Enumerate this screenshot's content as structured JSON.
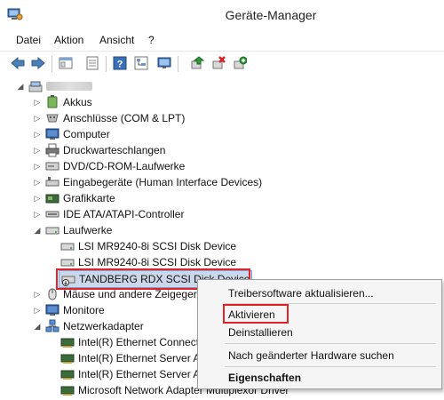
{
  "window": {
    "title": "Geräte-Manager",
    "icon": "device-manager-icon"
  },
  "menu": {
    "datei": "Datei",
    "aktion": "Aktion",
    "ansicht": "Ansicht",
    "help": "?"
  },
  "toolbar": {
    "icons": [
      "back-icon",
      "forward-icon",
      "properties-view-icon",
      "console-icon",
      "help-icon",
      "tree-icon",
      "update-driver-icon",
      "uninstall-icon",
      "scan-hardware-icon"
    ]
  },
  "tree": {
    "root_label_hidden": "",
    "nodes": [
      {
        "label": "Akkus",
        "expanded": false
      },
      {
        "label": "Anschlüsse (COM & LPT)",
        "expanded": false
      },
      {
        "label": "Computer",
        "expanded": false
      },
      {
        "label": "Druckwarteschlangen",
        "expanded": false
      },
      {
        "label": "DVD/CD-ROM-Laufwerke",
        "expanded": false
      },
      {
        "label": "Eingabegeräte (Human Interface Devices)",
        "expanded": false
      },
      {
        "label": "Grafikkarte",
        "expanded": false
      },
      {
        "label": "IDE ATA/ATAPI-Controller",
        "expanded": false
      },
      {
        "label": "Laufwerke",
        "expanded": true
      },
      {
        "label": "LSI MR9240-8i SCSI Disk Device",
        "child": true
      },
      {
        "label": "LSI MR9240-8i SCSI Disk Device",
        "child": true
      },
      {
        "label": "TANDBERG RDX SCSI Disk Device",
        "child": true,
        "selected": true
      },
      {
        "label": "Mäuse und andere Zeigegeräte",
        "expanded": false
      },
      {
        "label": "Monitore",
        "expanded": false
      },
      {
        "label": "Netzwerkadapter",
        "expanded": true
      },
      {
        "label": "Intel(R) Ethernet Connection",
        "child": true
      },
      {
        "label": "Intel(R) Ethernet Server Adapter",
        "child": true
      },
      {
        "label": "Intel(R) Ethernet Server Adapter",
        "child": true
      },
      {
        "label": "Microsoft Network Adapter Multiplexor Driver",
        "child": true
      }
    ]
  },
  "context_menu": {
    "items": [
      {
        "label": "Treibersoftware aktualisieren..."
      },
      {
        "label": "Aktivieren",
        "highlighted": true
      },
      {
        "label": "Deinstallieren"
      },
      {
        "label": "Nach geänderter Hardware suchen"
      },
      {
        "label": "Eigenschaften",
        "bold": true
      }
    ]
  },
  "colors": {
    "highlight_box": "#e0232a",
    "selection": "#ccd8ea"
  }
}
